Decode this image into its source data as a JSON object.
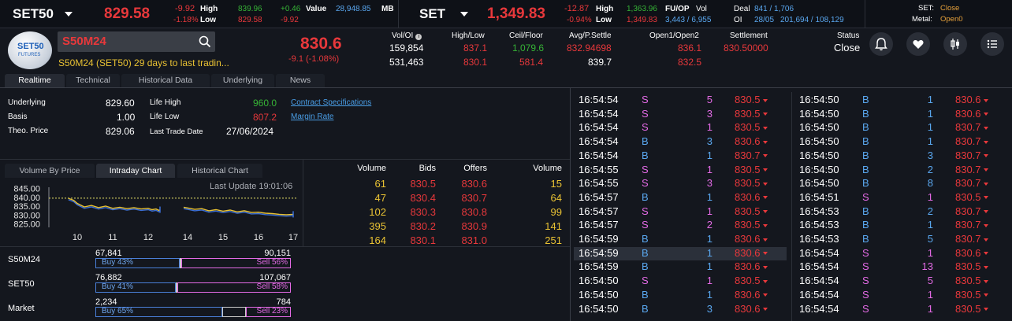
{
  "top": {
    "set50": {
      "name": "SET50",
      "last": "829.58",
      "chg": "-9.92",
      "pct": "-1.18%",
      "high_label": "High",
      "low_label": "Low",
      "high": "839.96",
      "low": "829.58",
      "high_chg": "+0.46",
      "low_chg": "-9.92",
      "value_label": "Value",
      "value": "28,948.85",
      "unit": "MB"
    },
    "set": {
      "name": "SET",
      "last": "1,349.83",
      "chg": "-12.87",
      "pct": "-0.94%",
      "high_label": "High",
      "low_label": "Low",
      "high": "1,363.96",
      "low": "1,349.83",
      "fuop_label": "FU/OP",
      "vol_label": "Vol",
      "oi_label": "OI",
      "vol": "3,443 / 6,955",
      "deal_label": "Deal",
      "deal": "841 / 1,706",
      "oi_date": "28/05",
      "oi": "201,694 / 108,129"
    },
    "status": {
      "set_label": "SET:",
      "set_val": "Close",
      "metal_label": "Metal:",
      "metal_val": "Open0"
    }
  },
  "instrument": {
    "logo_top": "SET50",
    "logo_bottom": "FUTURES",
    "symbol": "S50M24",
    "desc": "S50M24 (SET50) 29 days to last tradin...",
    "last": "830.6",
    "chg": "-9.1 (-1.08%)",
    "vol_oi_label": "Vol/OI",
    "vol": "159,854",
    "oi": "531,463",
    "hl_label": "High/Low",
    "high": "837.1",
    "low": "830.1",
    "cf_label": "Ceil/Floor",
    "ceil": "1,079.6",
    "floor": "581.4",
    "avg_label": "Avg/P.Settle",
    "avg": "832.94698",
    "psettle": "839.7",
    "open_label": "Open1/Open2",
    "open1": "836.1",
    "open2": "832.5",
    "settle_label": "Settlement",
    "settle": "830.50000",
    "status_label": "Status",
    "status": "Close"
  },
  "tabs": [
    "Realtime",
    "Technical",
    "Historical Data",
    "Underlying",
    "News"
  ],
  "info": {
    "underlying_label": "Underlying",
    "underlying": "829.60",
    "basis_label": "Basis",
    "basis": "1.00",
    "theo_label": "Theo. Price",
    "theo": "829.06",
    "lifehigh_label": "Life High",
    "lifehigh": "960.0",
    "lifelow_label": "Life Low",
    "lifelow": "807.2",
    "ltd_label": "Last Trade Date",
    "ltd": "27/06/2024",
    "link1": "Contract Specifications",
    "link2": "Margin Rate"
  },
  "chart_tabs": [
    "Volume By Price",
    "Intraday Chart",
    "Historical Chart"
  ],
  "chart_data": {
    "type": "line",
    "title": "Last Update 19:01:06",
    "yticks": [
      "845.00",
      "840.00",
      "835.00",
      "830.00",
      "825.00"
    ],
    "xticks": [
      "10",
      "11",
      "12",
      "14",
      "15",
      "16",
      "17"
    ],
    "ylim": [
      825,
      845
    ],
    "reference": 839.7,
    "series": [
      {
        "name": "",
        "color": "#e9c233",
        "values": [
          [
            9.75,
            839.6
          ],
          [
            9.9,
            838.5
          ],
          [
            10.0,
            836.8
          ],
          [
            10.2,
            834.8
          ],
          [
            10.4,
            835.6
          ],
          [
            10.6,
            834.4
          ],
          [
            10.8,
            835.2
          ],
          [
            11.0,
            834.0
          ],
          [
            11.2,
            834.6
          ],
          [
            11.4,
            833.8
          ],
          [
            11.6,
            834.4
          ],
          [
            11.8,
            833.6
          ],
          [
            12.0,
            834.0
          ],
          [
            12.2,
            833.2
          ],
          [
            12.4,
            833.6
          ],
          [
            12.55,
            832.8
          ],
          [
            12.6,
            833.2
          ]
        ]
      },
      {
        "name": "",
        "color": "#e9c233",
        "values": [
          [
            13.8,
            834.6
          ],
          [
            14.0,
            834.2
          ],
          [
            14.2,
            833.4
          ],
          [
            14.4,
            833.8
          ],
          [
            14.6,
            832.6
          ],
          [
            14.8,
            833.2
          ],
          [
            15.0,
            832.4
          ],
          [
            15.2,
            833.0
          ],
          [
            15.4,
            832.0
          ],
          [
            15.6,
            832.6
          ],
          [
            15.8,
            831.6
          ],
          [
            16.0,
            831.8
          ],
          [
            16.2,
            831.2
          ],
          [
            16.4,
            831.0
          ],
          [
            16.6,
            830.6
          ],
          [
            16.8,
            830.4
          ],
          [
            17.0,
            830.6
          ]
        ]
      }
    ]
  },
  "orderbook": {
    "headers": [
      "Volume",
      "Bids",
      "Offers",
      "Volume"
    ],
    "rows": [
      [
        "61",
        "830.5",
        "830.6",
        "15"
      ],
      [
        "47",
        "830.4",
        "830.7",
        "64"
      ],
      [
        "102",
        "830.3",
        "830.8",
        "99"
      ],
      [
        "395",
        "830.2",
        "830.9",
        "141"
      ],
      [
        "164",
        "830.1",
        "831.0",
        "251"
      ]
    ]
  },
  "buysell": [
    {
      "name": "S50M24",
      "buy_vol": "67,841",
      "sell_vol": "90,151",
      "buy": "Buy 43%",
      "sell": "Sell 56%",
      "buy_pct": 0.43,
      "sell_pct": 0.56
    },
    {
      "name": "SET50",
      "buy_vol": "76,882",
      "sell_vol": "107,067",
      "buy": "Buy 41%",
      "sell": "Sell 58%",
      "buy_pct": 0.41,
      "sell_pct": 0.58
    },
    {
      "name": "Market",
      "buy_vol": "2,234",
      "sell_vol": "784",
      "buy": "Buy 65%",
      "sell": "Sell 23%",
      "buy_pct": 0.65,
      "sell_pct": 0.23
    }
  ],
  "ticker_left": [
    [
      "16:54:54",
      "S",
      "5",
      "830.5"
    ],
    [
      "16:54:54",
      "S",
      "3",
      "830.5"
    ],
    [
      "16:54:54",
      "S",
      "1",
      "830.5"
    ],
    [
      "16:54:54",
      "B",
      "3",
      "830.6"
    ],
    [
      "16:54:54",
      "B",
      "1",
      "830.7"
    ],
    [
      "16:54:55",
      "S",
      "1",
      "830.5"
    ],
    [
      "16:54:55",
      "S",
      "3",
      "830.5"
    ],
    [
      "16:54:57",
      "B",
      "1",
      "830.6"
    ],
    [
      "16:54:57",
      "S",
      "1",
      "830.5"
    ],
    [
      "16:54:57",
      "S",
      "2",
      "830.5"
    ],
    [
      "16:54:59",
      "B",
      "1",
      "830.6"
    ],
    [
      "16:54:59",
      "B",
      "1",
      "830.6"
    ],
    [
      "16:54:59",
      "B",
      "1",
      "830.6"
    ],
    [
      "16:54:50",
      "S",
      "1",
      "830.5"
    ],
    [
      "16:54:50",
      "B",
      "1",
      "830.6"
    ],
    [
      "16:54:50",
      "B",
      "3",
      "830.6"
    ]
  ],
  "ticker_right": [
    [
      "16:54:50",
      "B",
      "1",
      "830.6"
    ],
    [
      "16:54:50",
      "B",
      "1",
      "830.6"
    ],
    [
      "16:54:50",
      "B",
      "1",
      "830.7"
    ],
    [
      "16:54:50",
      "B",
      "1",
      "830.7"
    ],
    [
      "16:54:50",
      "B",
      "3",
      "830.7"
    ],
    [
      "16:54:50",
      "B",
      "2",
      "830.7"
    ],
    [
      "16:54:50",
      "B",
      "8",
      "830.7"
    ],
    [
      "16:54:51",
      "S",
      "1",
      "830.5"
    ],
    [
      "16:54:53",
      "B",
      "2",
      "830.7"
    ],
    [
      "16:54:53",
      "B",
      "1",
      "830.7"
    ],
    [
      "16:54:53",
      "B",
      "5",
      "830.7"
    ],
    [
      "16:54:54",
      "S",
      "1",
      "830.6"
    ],
    [
      "16:54:54",
      "S",
      "13",
      "830.5"
    ],
    [
      "16:54:54",
      "S",
      "5",
      "830.5"
    ],
    [
      "16:54:54",
      "S",
      "1",
      "830.5"
    ],
    [
      "16:54:54",
      "S",
      "1",
      "830.5"
    ]
  ]
}
